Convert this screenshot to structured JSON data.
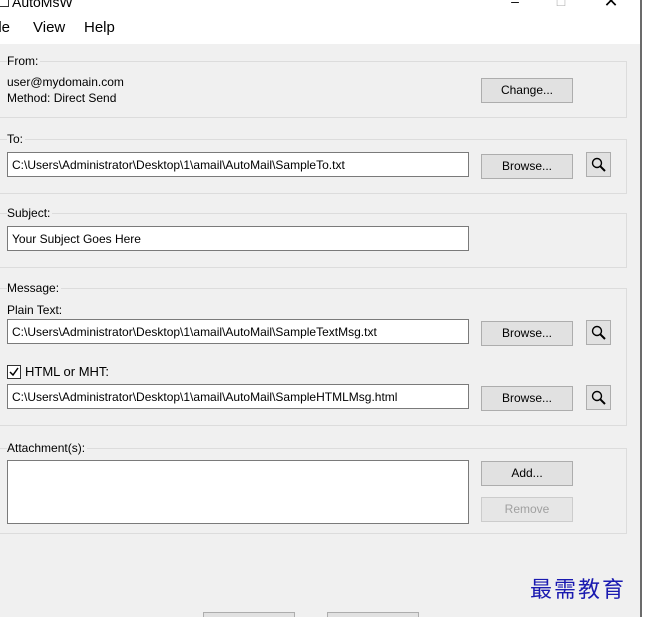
{
  "window": {
    "title": "AutoMsW",
    "controls": {
      "minimize": "–",
      "maximize": "□",
      "close": "✕"
    }
  },
  "menu": {
    "file": "ile",
    "view": "View",
    "help": "Help"
  },
  "from": {
    "label": "From:",
    "email": "user@mydomain.com",
    "method": "Method: Direct Send",
    "change_button": "Change..."
  },
  "to": {
    "label": "To:",
    "path": "C:\\Users\\Administrator\\Desktop\\1\\amail\\AutoMail\\SampleTo.txt",
    "browse_button": "Browse..."
  },
  "subject": {
    "label": "Subject:",
    "value": "Your Subject Goes Here"
  },
  "message": {
    "label": "Message:",
    "plain_label": "Plain Text:",
    "plain_path": "C:\\Users\\Administrator\\Desktop\\1\\amail\\AutoMail\\SampleTextMsg.txt",
    "browse_button": "Browse...",
    "html_label": "HTML or MHT:",
    "html_checked": true,
    "html_path": "C:\\Users\\Administrator\\Desktop\\1\\amail\\AutoMail\\SampleHTMLMsg.html",
    "html_browse_button": "Browse..."
  },
  "attachments": {
    "label": "Attachment(s):",
    "add_button": "Add...",
    "remove_button": "Remove",
    "items": []
  },
  "watermark": "最需教育",
  "icons": {
    "magnifier": "magnifier-icon",
    "checkmark": "checkmark-icon",
    "app": "app-icon"
  },
  "colors": {
    "background": "#f0f0f0",
    "button_face": "#e1e1e1",
    "watermark": "#1a1ab0"
  }
}
